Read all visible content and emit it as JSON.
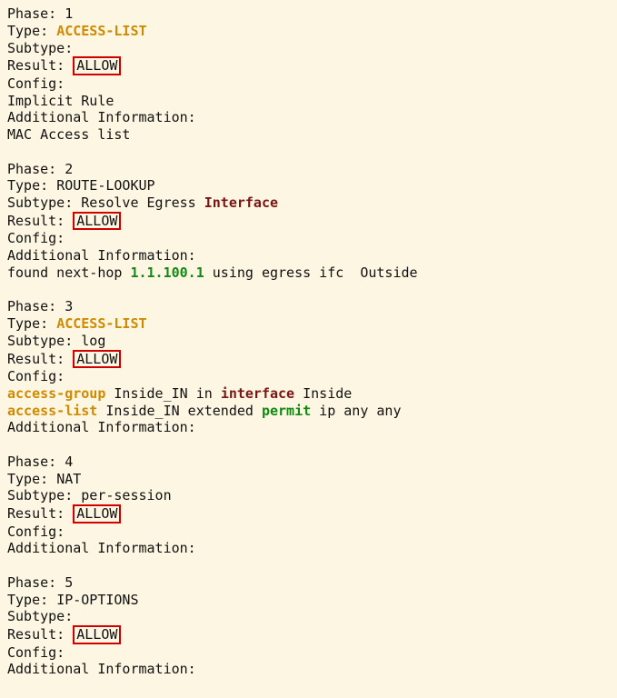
{
  "labels": {
    "phase": "Phase:",
    "type": "Type:",
    "subtype": "Subtype:",
    "result": "Result:",
    "config": "Config:",
    "additional_info": "Additional Information:"
  },
  "common": {
    "allow": "ALLOW"
  },
  "phase1": {
    "num": "1",
    "type": "ACCESS-LIST",
    "subtype": "",
    "config_line": "Implicit Rule",
    "info_line": "MAC Access list"
  },
  "phase2": {
    "num": "2",
    "type": "ROUTE-LOOKUP",
    "subtype_pre": "Resolve Egress ",
    "subtype_kw": "Interface",
    "info_pre": "found next-hop ",
    "next_hop": "1.1.100.1",
    "info_post": " using egress ifc  Outside"
  },
  "phase3": {
    "num": "3",
    "type": "ACCESS-LIST",
    "subtype": "log",
    "cfg1_kw": "access-group",
    "cfg1_mid": " Inside_IN in ",
    "cfg1_kw2": "interface",
    "cfg1_post": " Inside",
    "cfg2_kw": "access-list",
    "cfg2_mid": " Inside_IN extended ",
    "cfg2_kw2": "permit",
    "cfg2_post": " ip any any"
  },
  "phase4": {
    "num": "4",
    "type": "NAT",
    "subtype": "per-session"
  },
  "phase5": {
    "num": "5",
    "type": "IP-OPTIONS",
    "subtype": ""
  }
}
